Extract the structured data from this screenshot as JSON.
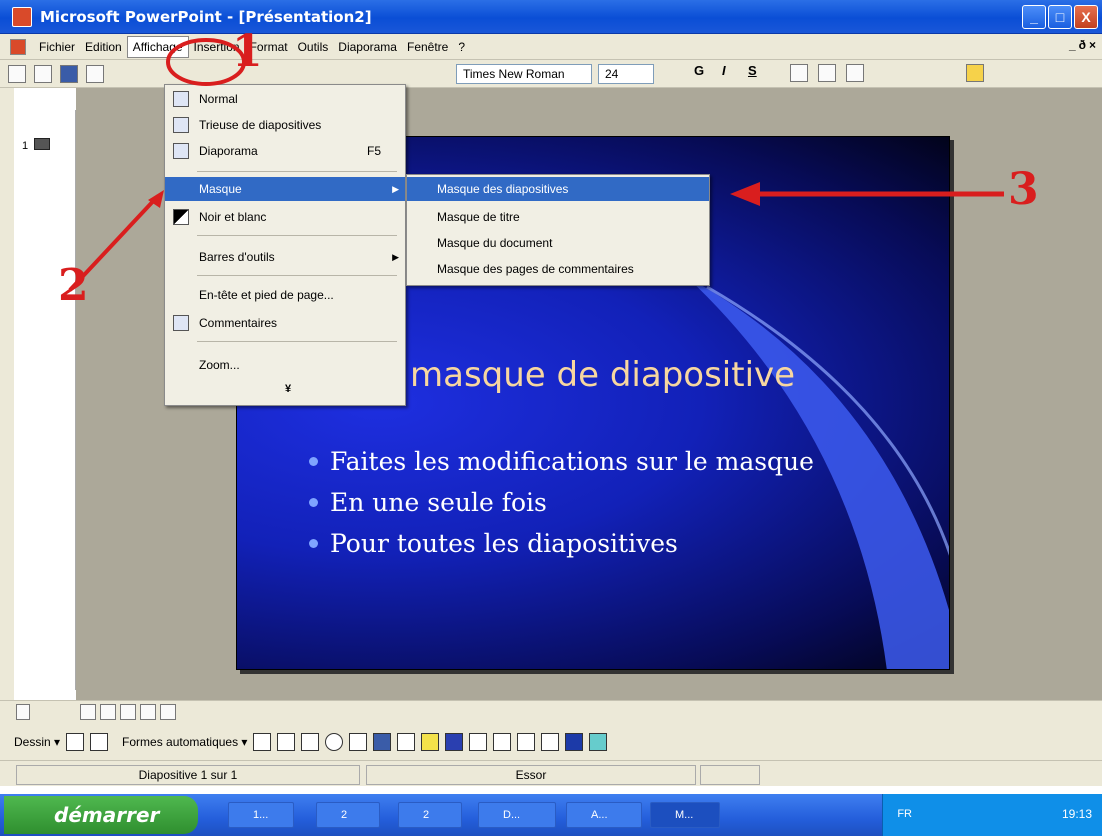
{
  "window": {
    "title": "Microsoft PowerPoint - [Présentation2]",
    "buttons": [
      "_",
      "□",
      "X"
    ]
  },
  "menubar": {
    "items": [
      "Fichier",
      "Edition",
      "Affichage",
      "Insertion",
      "Format",
      "Outils",
      "Diaporama",
      "Fenêtre",
      "?"
    ],
    "doc_buttons": [
      "_",
      "ð",
      "×"
    ]
  },
  "toolbar": {
    "font": "Times New Roman",
    "size": "24",
    "bold": "G",
    "italic": "I",
    "underline": "S"
  },
  "slide_pane": {
    "number": "1"
  },
  "view_menu": {
    "items": [
      {
        "label": "Normal",
        "icon": "normal-view-icon"
      },
      {
        "label": "Trieuse de diapositives",
        "icon": "slide-sorter-icon"
      },
      {
        "label": "Diaporama",
        "shortcut": "F5",
        "icon": "slideshow-icon"
      },
      {
        "label": "Masque",
        "submenu": true
      },
      {
        "label": "Noir et blanc",
        "icon": "black-white-icon"
      },
      {
        "label": "Barres d'outils",
        "submenu": true
      },
      {
        "label": "En-tête et pied de page..."
      },
      {
        "label": "Commentaires",
        "icon": "comments-icon"
      },
      {
        "label": "Zoom..."
      }
    ],
    "expand": "¥"
  },
  "master_submenu": {
    "items": [
      "Masque des diapositives",
      "Masque de titre",
      "Masque du document",
      "Masque des pages de commentaires"
    ]
  },
  "annotations": [
    "1",
    "2",
    "3"
  ],
  "slide": {
    "title": "masque de diapositive",
    "bullets": [
      "Faites les modifications sur le masque",
      "En une seule fois",
      "Pour toutes les diapositives"
    ]
  },
  "drawbar": {
    "draw": "Dessin ▾",
    "autoshapes": "Formes automatiques ▾"
  },
  "statusbar": {
    "slide": "Diapositive 1 sur 1",
    "design": "Essor"
  },
  "taskbar": {
    "start": "démarrer",
    "tasks": [
      "1...",
      "2",
      "2",
      "D...",
      "A...",
      "M..."
    ],
    "lang": "FR",
    "clock": "19:13"
  }
}
